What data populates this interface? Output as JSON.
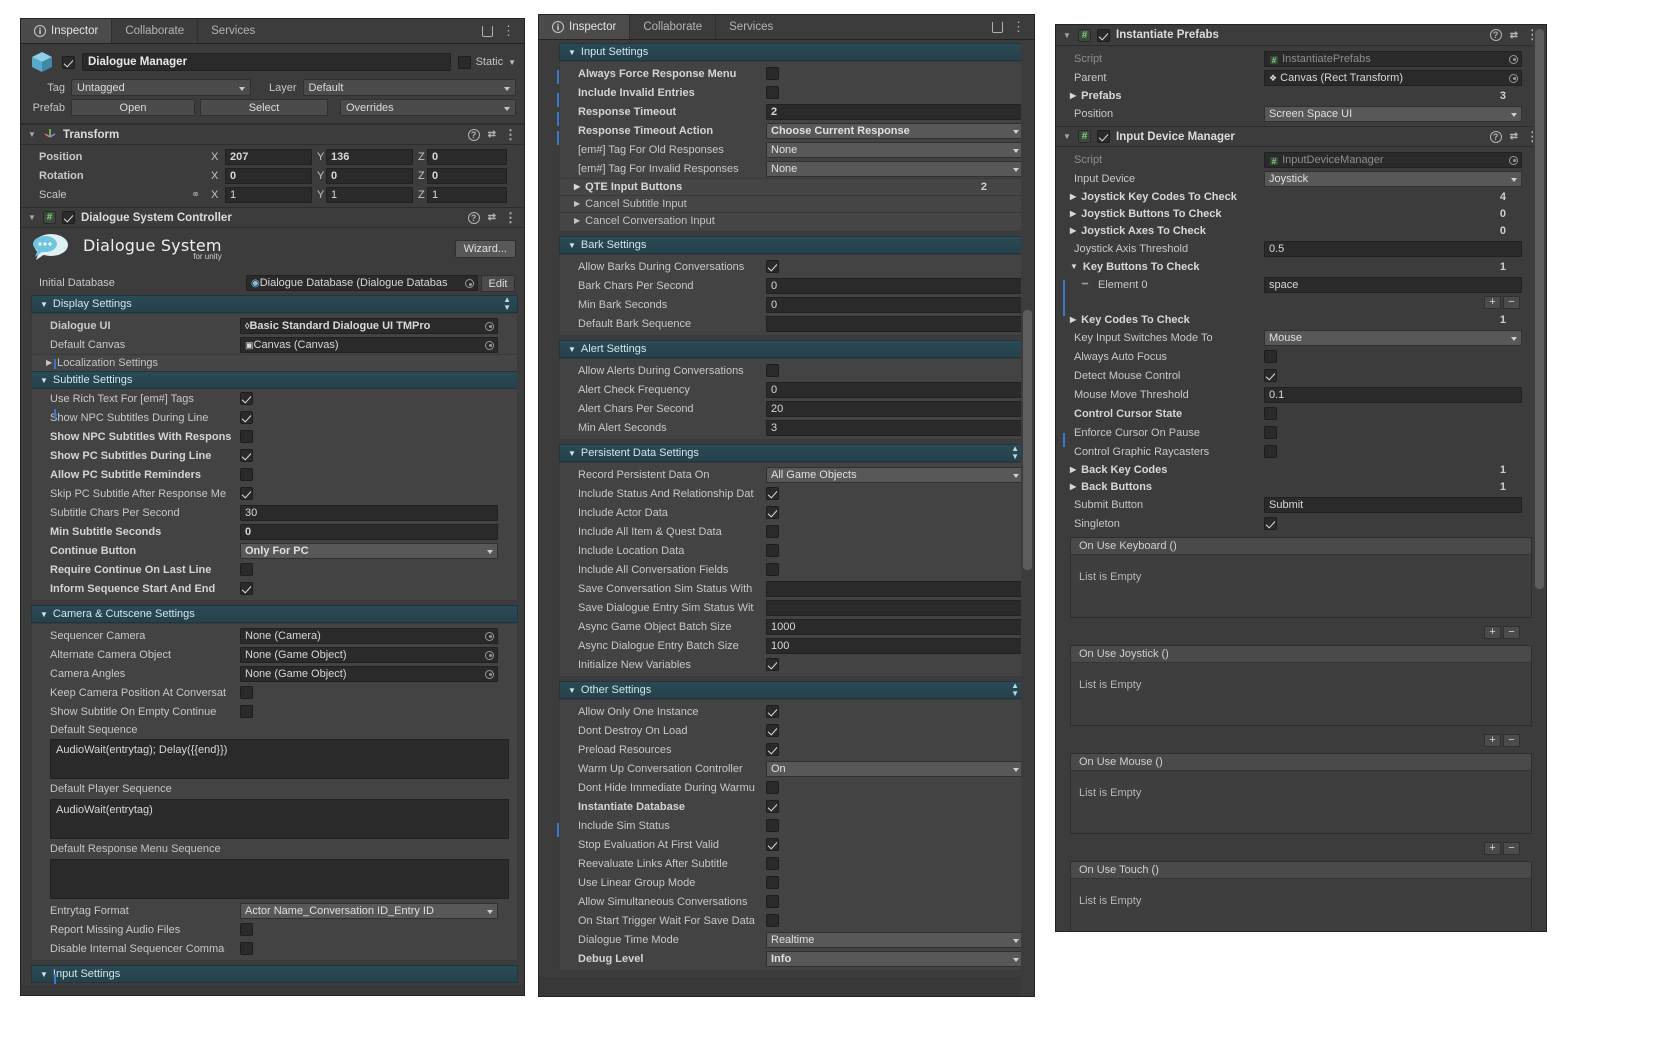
{
  "tabs": {
    "inspector": "Inspector",
    "collaborate": "Collaborate",
    "services": "Services"
  },
  "left": {
    "object": {
      "name": "Dialogue Manager",
      "static_label": "Static",
      "tag_label": "Tag",
      "tag_value": "Untagged",
      "layer_label": "Layer",
      "layer_value": "Default",
      "prefab_label": "Prefab",
      "open_button": "Open",
      "select_button": "Select",
      "overrides_button": "Overrides"
    },
    "transform": {
      "title": "Transform",
      "rows": [
        {
          "label": "Position",
          "x": "207",
          "y": "136",
          "z": "0"
        },
        {
          "label": "Rotation",
          "x": "0",
          "y": "0",
          "z": "0"
        },
        {
          "label": "Scale",
          "x": "1",
          "y": "1",
          "z": "1"
        }
      ],
      "axis_x": "X",
      "axis_y": "Y",
      "axis_z": "Z"
    },
    "controller": {
      "title": "Dialogue System Controller",
      "logo_text": "Dialogue System",
      "logo_sub": "for unity",
      "wizard_button": "Wizard...",
      "initial_database_label": "Initial Database",
      "initial_database_value": "Dialogue Database (Dialogue Databas",
      "edit_button": "Edit",
      "display_settings": "Display Settings",
      "dialogue_ui_label": "Dialogue UI",
      "dialogue_ui_value": "Basic Standard Dialogue UI TMPro",
      "default_canvas_label": "Default Canvas",
      "default_canvas_value": "Canvas (Canvas)",
      "localization_settings": "Localization Settings",
      "subtitle_settings": "Subtitle Settings",
      "subtitle_rows": [
        {
          "label": "Use Rich Text For [em#] Tags",
          "type": "check",
          "checked": true,
          "bold": false
        },
        {
          "label": "Show NPC Subtitles During Line",
          "type": "check",
          "checked": true,
          "bold": false
        },
        {
          "label": "Show NPC Subtitles With Respons",
          "type": "check",
          "checked": false,
          "bold": true
        },
        {
          "label": "Show PC Subtitles During Line",
          "type": "check",
          "checked": true,
          "bold": true
        },
        {
          "label": "Allow PC Subtitle Reminders",
          "type": "check",
          "checked": false,
          "bold": true
        },
        {
          "label": "Skip PC Subtitle After Response Me",
          "type": "check",
          "checked": true,
          "bold": false
        },
        {
          "label": "Subtitle Chars Per Second",
          "type": "text",
          "value": "30",
          "bold": false
        },
        {
          "label": "Min Subtitle Seconds",
          "type": "text",
          "value": "0",
          "bold": true
        },
        {
          "label": "Continue Button",
          "type": "popup",
          "value": "Only For PC",
          "bold": true
        },
        {
          "label": "Require Continue On Last Line",
          "type": "check",
          "checked": false,
          "bold": true
        },
        {
          "label": "Inform Sequence Start And End",
          "type": "check",
          "checked": true,
          "bold": true
        }
      ],
      "camera_settings": "Camera & Cutscene Settings",
      "camera_rows": [
        {
          "label": "Sequencer Camera",
          "type": "object",
          "value": "None (Camera)"
        },
        {
          "label": "Alternate Camera Object",
          "type": "object",
          "value": "None (Game Object)"
        },
        {
          "label": "Camera Angles",
          "type": "object",
          "value": "None (Game Object)"
        },
        {
          "label": "Keep Camera Position At Conversat",
          "type": "check",
          "checked": false
        },
        {
          "label": "Show Subtitle On Empty Continue",
          "type": "check",
          "checked": false
        }
      ],
      "default_sequence_label": "Default Sequence",
      "default_sequence_value": "AudioWait(entrytag); Delay({{end}})",
      "default_player_sequence_label": "Default Player Sequence",
      "default_player_sequence_value": "AudioWait(entrytag)",
      "default_response_menu_sequence_label": "Default Response Menu Sequence",
      "default_response_menu_sequence_value": "",
      "entrytag_format_label": "Entrytag Format",
      "entrytag_format_value": "Actor Name_Conversation ID_Entry ID",
      "report_missing_label": "Report Missing Audio Files",
      "disable_internal_label": "Disable Internal Sequencer Comma",
      "input_settings_footer": "Input Settings"
    }
  },
  "mid": {
    "input_settings": "Input Settings",
    "input_rows": [
      {
        "label": "Always Force Response Menu",
        "type": "check",
        "checked": false,
        "bold": true
      },
      {
        "label": "Include Invalid Entries",
        "type": "check",
        "checked": false,
        "bold": true
      },
      {
        "label": "Response Timeout",
        "type": "text",
        "value": "2",
        "bold": true
      },
      {
        "label": "Response Timeout Action",
        "type": "popup",
        "value": "Choose Current Response",
        "bold": true
      },
      {
        "label": "[em#] Tag For Old Responses",
        "type": "popup",
        "value": "None",
        "bold": false
      },
      {
        "label": "[em#] Tag For Invalid Responses",
        "type": "popup",
        "value": "None",
        "bold": false
      }
    ],
    "qte_label": "QTE Input Buttons",
    "qte_count": "2",
    "cancel_subtitle_input": "Cancel Subtitle Input",
    "cancel_conversation_input": "Cancel Conversation Input",
    "bark_settings": "Bark Settings",
    "bark_rows": [
      {
        "label": "Allow Barks During Conversations",
        "type": "check",
        "checked": true
      },
      {
        "label": "Bark Chars Per Second",
        "type": "text",
        "value": "0"
      },
      {
        "label": "Min Bark Seconds",
        "type": "text",
        "value": "0"
      },
      {
        "label": "Default Bark Sequence",
        "type": "text",
        "value": ""
      }
    ],
    "alert_settings": "Alert Settings",
    "alert_rows": [
      {
        "label": "Allow Alerts During Conversations",
        "type": "check",
        "checked": false
      },
      {
        "label": "Alert Check Frequency",
        "type": "text",
        "value": "0"
      },
      {
        "label": "Alert Chars Per Second",
        "type": "text",
        "value": "20"
      },
      {
        "label": "Min Alert Seconds",
        "type": "text",
        "value": "3"
      }
    ],
    "persistent_settings": "Persistent Data Settings",
    "persistent_rows": [
      {
        "label": "Record Persistent Data On",
        "type": "popup",
        "value": "All Game Objects"
      },
      {
        "label": "Include Status And Relationship Dat",
        "type": "check",
        "checked": true
      },
      {
        "label": "Include Actor Data",
        "type": "check",
        "checked": true
      },
      {
        "label": "Include All Item & Quest Data",
        "type": "check",
        "checked": false
      },
      {
        "label": "Include Location Data",
        "type": "check",
        "checked": false
      },
      {
        "label": "Include All Conversation Fields",
        "type": "check",
        "checked": false
      },
      {
        "label": "Save Conversation Sim Status With",
        "type": "text",
        "value": ""
      },
      {
        "label": "Save Dialogue Entry Sim Status Wit",
        "type": "text",
        "value": ""
      },
      {
        "label": "Async Game Object Batch Size",
        "type": "text",
        "value": "1000"
      },
      {
        "label": "Async Dialogue Entry Batch Size",
        "type": "text",
        "value": "100"
      },
      {
        "label": "Initialize New Variables",
        "type": "check",
        "checked": true
      }
    ],
    "other_settings": "Other Settings",
    "other_rows": [
      {
        "label": "Allow Only One Instance",
        "type": "check",
        "checked": true,
        "bold": false
      },
      {
        "label": "Dont Destroy On Load",
        "type": "check",
        "checked": true,
        "bold": false
      },
      {
        "label": "Preload Resources",
        "type": "check",
        "checked": true,
        "bold": false
      },
      {
        "label": "Warm Up Conversation Controller",
        "type": "popup",
        "value": "On",
        "bold": false
      },
      {
        "label": "Dont Hide Immediate During Warmu",
        "type": "check",
        "checked": false,
        "bold": false
      },
      {
        "label": "Instantiate Database",
        "type": "check",
        "checked": true,
        "bold": true
      },
      {
        "label": "Include Sim Status",
        "type": "check",
        "checked": false,
        "bold": false
      },
      {
        "label": "Stop Evaluation At First Valid",
        "type": "check",
        "checked": true,
        "bold": false
      },
      {
        "label": "Reevaluate Links After Subtitle",
        "type": "check",
        "checked": false,
        "bold": false
      },
      {
        "label": "Use Linear Group Mode",
        "type": "check",
        "checked": false,
        "bold": false
      },
      {
        "label": "Allow Simultaneous Conversations",
        "type": "check",
        "checked": false,
        "bold": false
      },
      {
        "label": "On Start Trigger Wait For Save Data",
        "type": "check",
        "checked": false,
        "bold": false
      },
      {
        "label": "Dialogue Time Mode",
        "type": "popup",
        "value": "Realtime",
        "bold": false
      },
      {
        "label": "Debug Level",
        "type": "popup",
        "value": "Info",
        "bold": true
      }
    ]
  },
  "right": {
    "instantiate_prefabs": {
      "title": "Instantiate Prefabs",
      "script_label": "Script",
      "script_value": "InstantiatePrefabs",
      "parent_label": "Parent",
      "parent_value": "Canvas (Rect Transform)",
      "prefabs_label": "Prefabs",
      "prefabs_count": "3",
      "position_label": "Position",
      "position_value": "Screen Space UI"
    },
    "input_device_manager": {
      "title": "Input Device Manager",
      "script_label": "Script",
      "script_value": "InputDeviceManager",
      "input_device_label": "Input Device",
      "input_device_value": "Joystick",
      "joystick_key_codes_label": "Joystick Key Codes To Check",
      "joystick_key_codes_count": "4",
      "joystick_buttons_label": "Joystick Buttons To Check",
      "joystick_buttons_count": "0",
      "joystick_axes_label": "Joystick Axes To Check",
      "joystick_axes_count": "0",
      "joystick_axis_threshold_label": "Joystick Axis Threshold",
      "joystick_axis_threshold_value": "0.5",
      "key_buttons_label": "Key Buttons To Check",
      "key_buttons_count": "1",
      "element_0_label": "Element 0",
      "element_0_value": "space",
      "key_codes_label": "Key Codes To Check",
      "key_codes_count": "1",
      "key_input_mode_label": "Key Input Switches Mode To",
      "key_input_mode_value": "Mouse",
      "always_auto_focus_label": "Always Auto Focus",
      "detect_mouse_label": "Detect Mouse Control",
      "mouse_move_threshold_label": "Mouse Move Threshold",
      "mouse_move_threshold_value": "0.1",
      "control_cursor_label": "Control Cursor State",
      "enforce_cursor_label": "Enforce Cursor On Pause",
      "control_graphic_label": "Control Graphic Raycasters",
      "back_key_codes_label": "Back Key Codes",
      "back_key_codes_count": "1",
      "back_buttons_label": "Back Buttons",
      "back_buttons_count": "1",
      "submit_button_label": "Submit Button",
      "submit_button_value": "Submit",
      "singleton_label": "Singleton"
    },
    "events": [
      {
        "title": "On Use Keyboard ()",
        "empty": "List is Empty"
      },
      {
        "title": "On Use Joystick ()",
        "empty": "List is Empty"
      },
      {
        "title": "On Use Mouse ()",
        "empty": "List is Empty"
      },
      {
        "title": "On Use Touch ()",
        "empty": "List is Empty"
      }
    ],
    "plus": "+",
    "minus": "−"
  },
  "colors": {
    "section_header": "#2b4a55",
    "accent_blue": "#3a79c9",
    "panel_bg": "#3c3c3c"
  }
}
